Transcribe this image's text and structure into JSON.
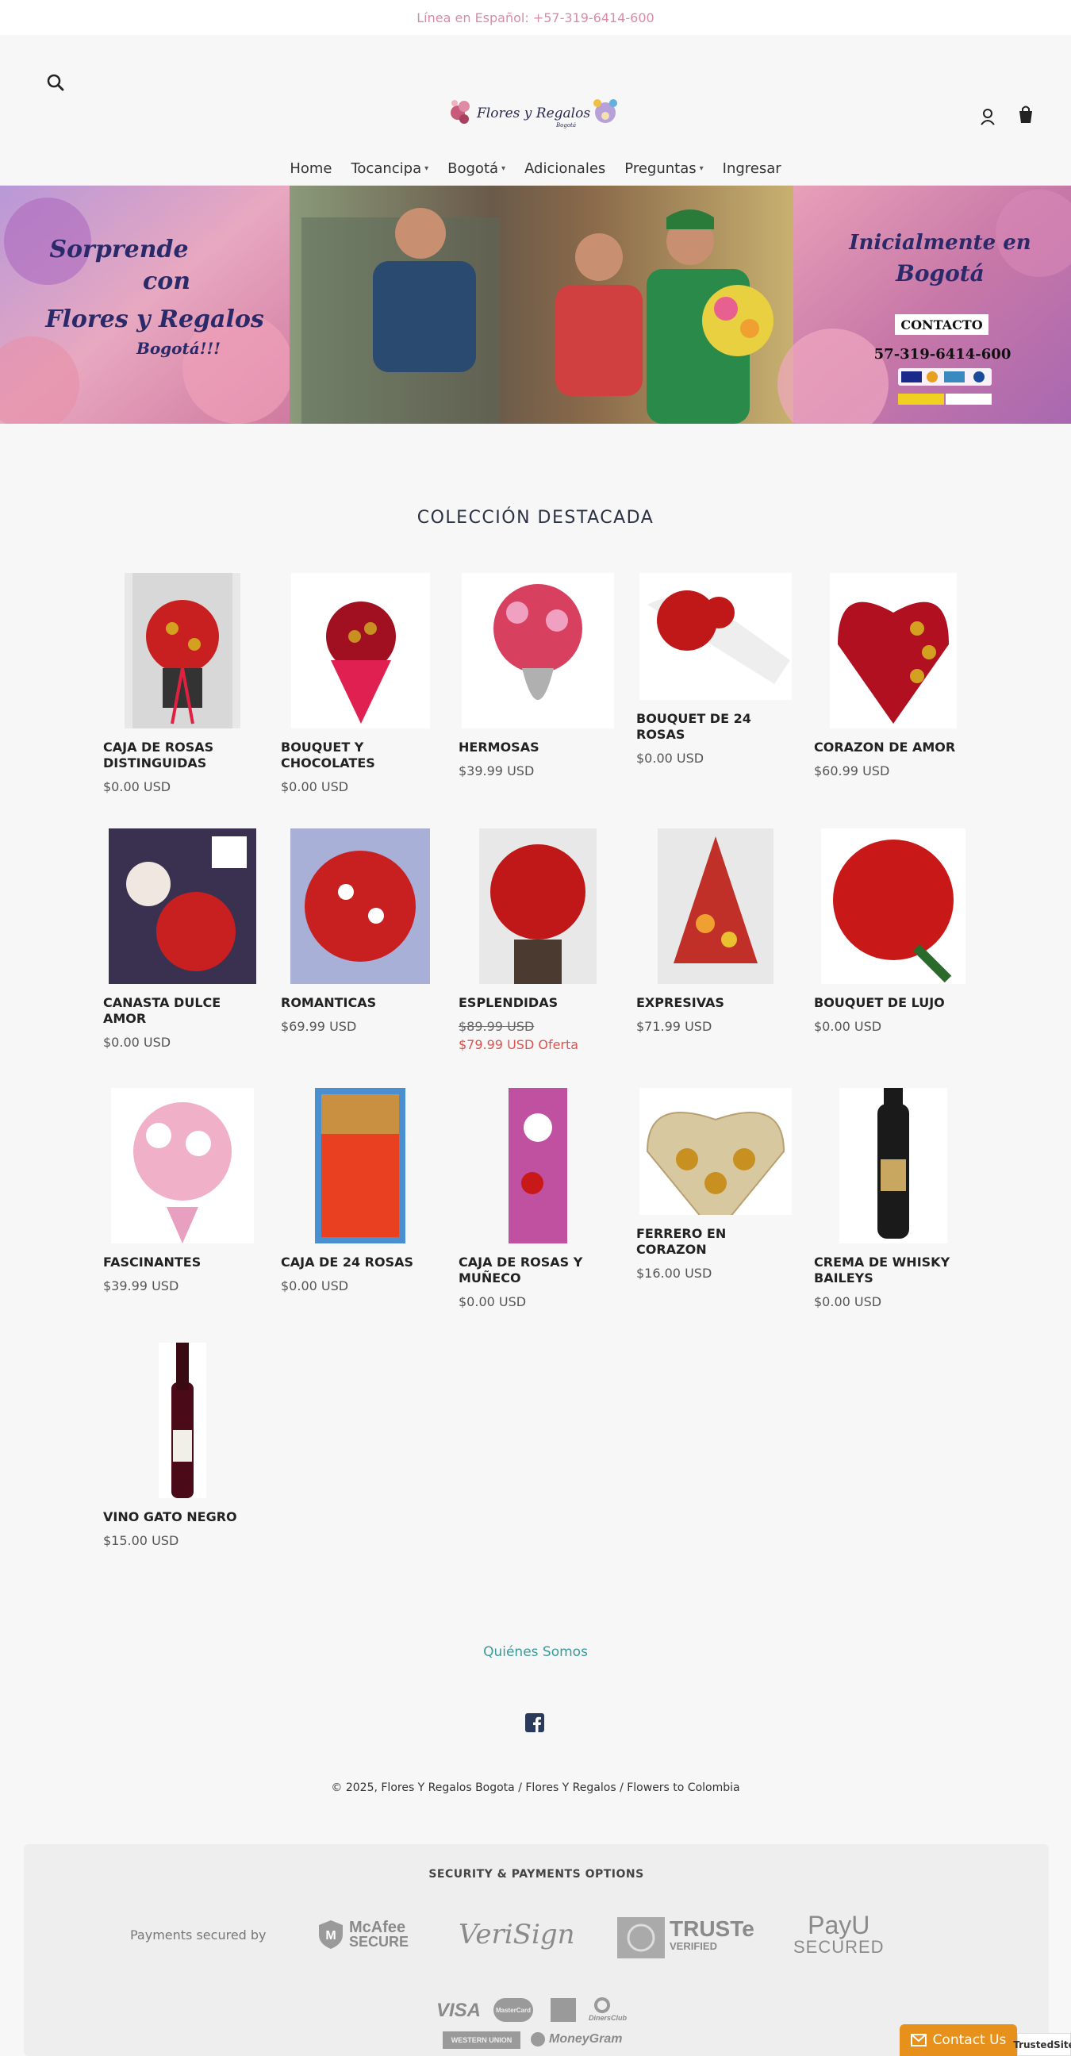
{
  "announcement": "Línea en Español: +57-319-6414-600",
  "header": {
    "logo_text": "Flores y Regalos",
    "logo_sub": "Bogotá"
  },
  "nav": [
    {
      "label": "Home",
      "dropdown": false
    },
    {
      "label": "Tocancipa",
      "dropdown": true
    },
    {
      "label": "Bogotá",
      "dropdown": true
    },
    {
      "label": "Adicionales",
      "dropdown": false
    },
    {
      "label": "Preguntas",
      "dropdown": true
    },
    {
      "label": "Ingresar",
      "dropdown": false
    }
  ],
  "banner": {
    "left_line1": "Sorprende",
    "left_line2": "con",
    "left_line3": "Flores y Regalos",
    "left_line4": "Bogotá!!!",
    "right_line1": "Inicialmente en",
    "right_line2": "Bogotá",
    "contact_label": "CONTACTO",
    "phone": "57-319-6414-600"
  },
  "section_title": "COLECCIÓN DESTACADA",
  "products": [
    {
      "name": "CAJA DE ROSAS DISTINGUIDAS",
      "price": "$0.00 USD"
    },
    {
      "name": "BOUQUET Y CHOCOLATES",
      "price": "$0.00 USD"
    },
    {
      "name": "HERMOSAS",
      "price": "$39.99 USD"
    },
    {
      "name": "BOUQUET DE 24 ROSAS",
      "price": "$0.00 USD"
    },
    {
      "name": "CORAZON DE AMOR",
      "price": "$60.99 USD"
    },
    {
      "name": "CANASTA DULCE AMOR",
      "price": "$0.00 USD"
    },
    {
      "name": "ROMANTICAS",
      "price": "$69.99 USD"
    },
    {
      "name": "ESPLENDIDAS",
      "price": "$89.99 USD",
      "sale_price": "$79.99 USD Oferta"
    },
    {
      "name": "EXPRESIVAS",
      "price": "$71.99 USD"
    },
    {
      "name": "BOUQUET DE LUJO",
      "price": "$0.00 USD"
    },
    {
      "name": "FASCINANTES",
      "price": "$39.99 USD"
    },
    {
      "name": "CAJA DE 24 ROSAS",
      "price": "$0.00 USD"
    },
    {
      "name": "CAJA DE ROSAS Y MUÑECO",
      "price": "$0.00 USD"
    },
    {
      "name": "FERRERO EN CORAZON",
      "price": "$16.00 USD"
    },
    {
      "name": "CREMA DE WHISKY BAILEYS",
      "price": "$0.00 USD"
    },
    {
      "name": "VINO GATO NEGRO",
      "price": "$15.00 USD"
    }
  ],
  "footer": {
    "link": "Quiénes Somos",
    "copyright": "© 2025, Flores Y Regalos Bogota / Flores Y Regalos / Flowers to Colombia"
  },
  "trust": {
    "title": "SECURITY & PAYMENTS OPTIONS",
    "payments_secured": "Payments secured by",
    "mcafee": "McAfee",
    "mcafee_sub": "SECURE",
    "verisign": "VeriSign",
    "truste": "TRUSTe",
    "truste_sub": "VERIFIED",
    "payu": "PayU",
    "payu_sub": "SECURED",
    "visa": "VISA",
    "mastercard": "MasterCard",
    "diners": "DinersClub",
    "western_union": "WESTERN UNION",
    "moneygram": "MoneyGram"
  },
  "contact_us": "Contact Us",
  "trusted_site": "TrustedSite",
  "colors": {
    "accent_pink": "#d88ca4",
    "link_teal": "#3a9a9a",
    "sale_red": "#d9534f",
    "contact_orange": "#e8901c"
  }
}
